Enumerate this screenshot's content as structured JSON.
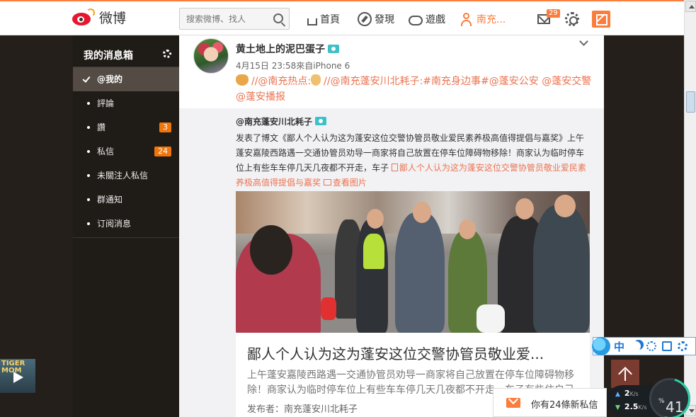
{
  "nav": {
    "logo_text": "微博",
    "search_placeholder": "搜索微博、找人",
    "home": "首頁",
    "discover": "發現",
    "games": "遊戲",
    "user": "南充...",
    "mail_badge": "29"
  },
  "sidebar": {
    "title": "我的消息箱",
    "items": [
      {
        "label": "@我的",
        "count": ""
      },
      {
        "label": "評論",
        "count": ""
      },
      {
        "label": "讚",
        "count": "3"
      },
      {
        "label": "私信",
        "count": "24"
      },
      {
        "label": "未關注人私信",
        "count": ""
      },
      {
        "label": "群通知",
        "count": ""
      },
      {
        "label": "订阅消息",
        "count": ""
      }
    ]
  },
  "post": {
    "author": "黄土地上的泥巴蛋子",
    "meta": "4月15日 23:58來自iPhone 6",
    "text_1": "//@南充热点:",
    "text_2": "//@南充蓬安川北耗子:#南充身边事#@蓬安公安 @蓬安交警 @蓬安播报"
  },
  "repost": {
    "author": "@南充蓬安川北耗子",
    "body": "发表了博文《鄙人个人认为这为蓬安这位交警协管员敬业爱民素养极高值得提倡与嘉奖》上午蓬安嘉陵西路遇一交通协管员劝导一商家将自己放置在停车位障碍物移除！商家认为临时停车位上有些车车停几天几夜都不开走，车子",
    "link": "鄙人个人认为这为蓬安这位交警协管员敬业爱民素养极高值得提倡与嘉奖",
    "view_image": "查看图片"
  },
  "card": {
    "title": "鄙人个人认为这为蓬安这位交警协管员敬业爱...",
    "desc": "上午蓬安嘉陵西路遇一交通协管员劝导一商家将自己放置在停车位障碍物移除！商家认为临时停车位上有些车车停几天几夜都不开走，车子有些住自己",
    "publisher": "发布者：南充蓬安川北耗子"
  },
  "ime": {
    "label": "中"
  },
  "notify": {
    "text": "你有24條新私信"
  },
  "speed": {
    "up": "2",
    "up_unit": "K/s",
    "down": "2.5",
    "down_unit": "K/s",
    "cpu": "41",
    "cpu_unit": "%"
  },
  "ad": {
    "text": "TIGER MOM"
  }
}
